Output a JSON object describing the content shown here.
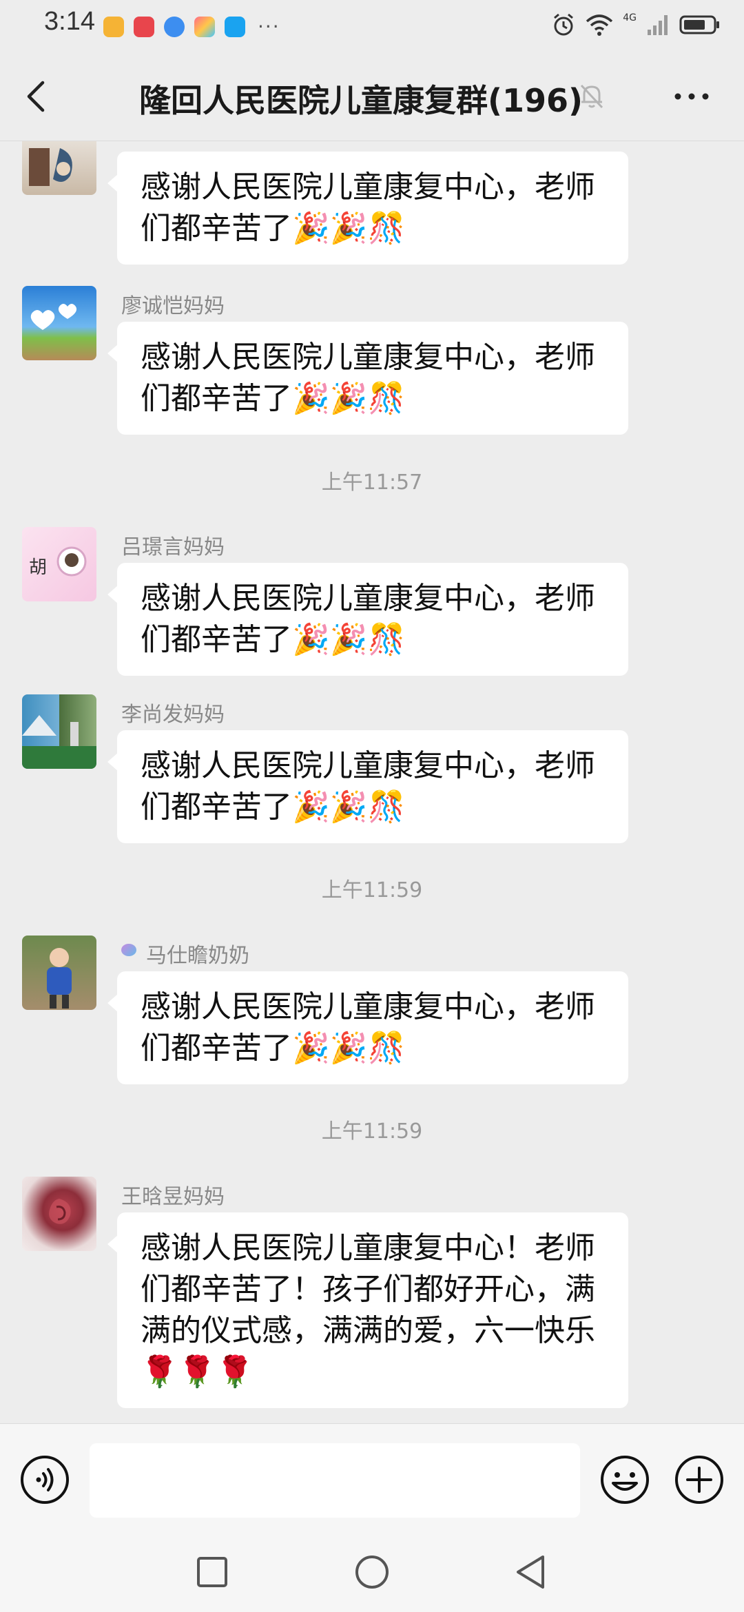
{
  "status_bar": {
    "time": "3:14",
    "overflow": "···",
    "network": "4G",
    "icons": [
      "alarm-icon",
      "wifi-icon",
      "signal-icon",
      "battery-icon"
    ]
  },
  "header": {
    "title": "隆回人民医院儿童康复群(196)",
    "icons": [
      "back-icon",
      "mute-bell-icon",
      "more-icon"
    ]
  },
  "messages": [
    {
      "type": "message",
      "sender": "",
      "text": "感谢人民医院儿童康复中心，老师们都辛苦了",
      "emojis": "🎉🎉🎊"
    },
    {
      "type": "message",
      "sender": "廖诚恺妈妈",
      "text": "感谢人民医院儿童康复中心，老师们都辛苦了",
      "emojis": "🎉🎉🎊"
    },
    {
      "type": "time",
      "text": "上午11:57"
    },
    {
      "type": "message",
      "sender": "吕璟言妈妈",
      "text": "感谢人民医院儿童康复中心，老师们都辛苦了",
      "emojis": "🎉🎉🎊",
      "avatar_text": "胡"
    },
    {
      "type": "message",
      "sender": "李尚发妈妈",
      "text": "感谢人民医院儿童康复中心，老师们都辛苦了",
      "emojis": "🎉🎉🎊"
    },
    {
      "type": "time",
      "text": "上午11:59"
    },
    {
      "type": "message",
      "sender": "马仕瞻奶奶",
      "text": "感谢人民医院儿童康复中心，老师们都辛苦了",
      "emojis": "🎉🎉🎊"
    },
    {
      "type": "time",
      "text": "上午11:59"
    },
    {
      "type": "message",
      "sender": "王晗昱妈妈",
      "text": "感谢人民医院儿童康复中心！老师们都辛苦了！孩子们都好开心，满满的仪式感，满满的爱，六一快乐",
      "emojis": "🌹🌹🌹"
    }
  ],
  "input_bar": {
    "placeholder": "",
    "icons": [
      "voice-icon",
      "emoji-icon",
      "plus-icon"
    ]
  },
  "nav_bar": {
    "icons": [
      "recent-apps-icon",
      "home-icon",
      "back-triangle-icon"
    ]
  },
  "colors": {
    "background": "#ededed",
    "bubble": "#ffffff",
    "sender_text": "#888888",
    "timestamp_text": "#999999"
  }
}
